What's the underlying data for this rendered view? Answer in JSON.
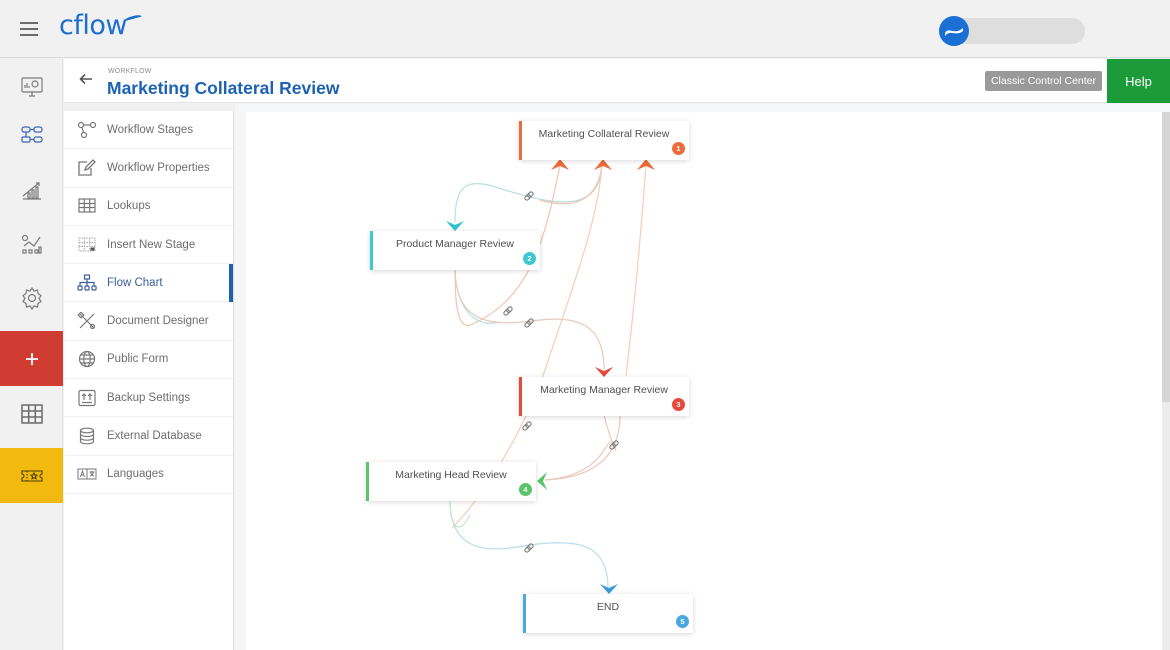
{
  "app": {
    "logo_text": "cflow"
  },
  "header": {
    "breadcrumb": "WORKFLOW",
    "title": "Marketing Collateral Review",
    "classic_button": "Classic Control Center",
    "help_button": "Help"
  },
  "rail": {
    "items": [
      {
        "icon": "dashboard-monitor-icon"
      },
      {
        "icon": "workflow-builder-icon"
      },
      {
        "icon": "reports-chart-icon"
      },
      {
        "icon": "analytics-icon"
      },
      {
        "icon": "settings-gear-icon"
      },
      {
        "icon": "plus-icon",
        "label": "+"
      },
      {
        "icon": "table-grid-icon"
      },
      {
        "icon": "ticket-star-icon"
      }
    ]
  },
  "menu": {
    "items": [
      {
        "label": "Workflow Stages",
        "icon": "workflow-stages-icon"
      },
      {
        "label": "Workflow Properties",
        "icon": "edit-icon"
      },
      {
        "label": "Lookups",
        "icon": "lookups-table-icon"
      },
      {
        "label": "Insert New Stage",
        "icon": "insert-stage-icon"
      },
      {
        "label": "Flow Chart",
        "icon": "flow-chart-icon",
        "active": true
      },
      {
        "label": "Document Designer",
        "icon": "document-designer-icon"
      },
      {
        "label": "Public Form",
        "icon": "globe-icon"
      },
      {
        "label": "Backup Settings",
        "icon": "backup-icon"
      },
      {
        "label": "External Database",
        "icon": "database-icon"
      },
      {
        "label": "Languages",
        "icon": "languages-icon"
      }
    ]
  },
  "flow": {
    "nodes": [
      {
        "name": "Marketing Collateral Review",
        "number": "1",
        "color": "#ee6b3b"
      },
      {
        "name": "Product Manager Review",
        "number": "2",
        "color": "#3cc8cf"
      },
      {
        "name": "Marketing Manager Review",
        "number": "3",
        "color": "#e8483a"
      },
      {
        "name": "Marketing Head Review",
        "number": "4",
        "color": "#5cc46a"
      },
      {
        "name": "END",
        "number": "5",
        "color": "#4aa8e0"
      }
    ]
  },
  "colors": {
    "brand_blue": "#1c6fd1",
    "title_blue": "#1b62b3",
    "help_green": "#1c9b3a",
    "add_red": "#d13c32",
    "star_yellow": "#f2b90f"
  }
}
